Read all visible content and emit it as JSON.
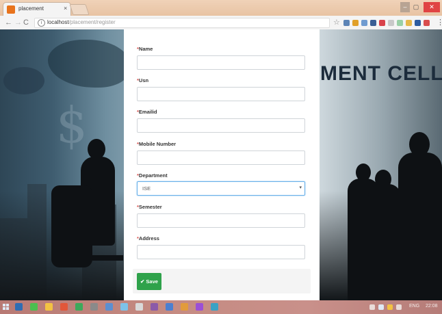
{
  "browser": {
    "tab_title": "placement",
    "tab_close": "×",
    "url_host": "localhost",
    "url_path": "/placement/register",
    "window": {
      "min": "–",
      "max": "▢",
      "close": "✕"
    },
    "nav": {
      "back": "←",
      "forward": "→",
      "reload": "C"
    },
    "info": "i",
    "star": "☆",
    "menu": "⋮",
    "extension_colors": [
      "#5c84b6",
      "#e1a12a",
      "#6f9bd0",
      "#3a5f95",
      "#d9434b",
      "#c9c9c9",
      "#9ad0a6",
      "#e7b84a",
      "#2e5da0",
      "#d94d4d"
    ]
  },
  "page": {
    "banner": "MENT CELL"
  },
  "form": {
    "required_mark": "*",
    "fields": [
      {
        "label": "Name",
        "value": ""
      },
      {
        "label": "Usn",
        "value": ""
      },
      {
        "label": "Emailid",
        "value": ""
      },
      {
        "label": "Mobile Number",
        "value": ""
      },
      {
        "label": "Department",
        "type": "select",
        "value": "ISE"
      },
      {
        "label": "Semester",
        "value": ""
      },
      {
        "label": "Address",
        "value": ""
      }
    ],
    "save_label": "✔ Save"
  },
  "taskbar": {
    "icon_colors": [
      "#2f6db3",
      "#4bbf4f",
      "#f3c242",
      "#e2573a",
      "#3da95b",
      "#8a8a8a",
      "#5b8fd1",
      "#7ec2e8",
      "#d9d9d9",
      "#8c5aa8",
      "#4b7fd0",
      "#e29b3b",
      "#9b4fd6",
      "#3aa2c4"
    ],
    "language": "ENG",
    "time": "22:08"
  },
  "colors": {
    "save_button": "#2fa24b",
    "required": "#d9534f",
    "select_focus": "#66afe9"
  }
}
